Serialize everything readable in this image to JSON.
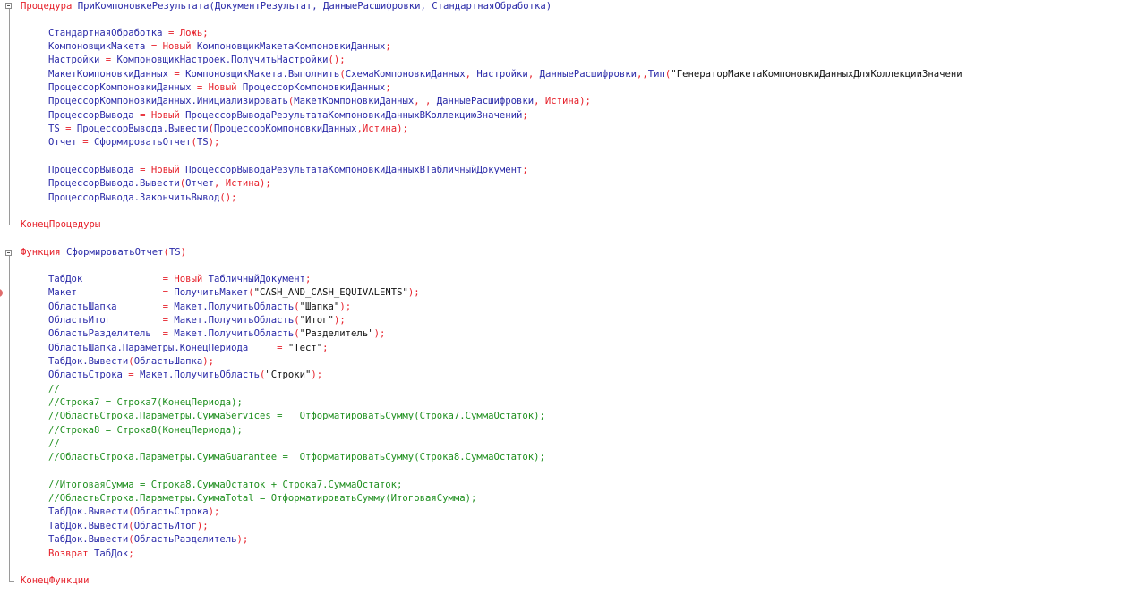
{
  "colors": {
    "keyword": "#e6202a",
    "identifier": "#2a2aa8",
    "string": "#111111",
    "comment": "#1f8f1f",
    "background": "#ffffff"
  },
  "icons": [
    "fold-collapse-icon",
    "breakpoint-icon"
  ],
  "lines": [
    [
      {
        "t": "k",
        "v": "Процедура "
      },
      {
        "t": "t",
        "v": "ПриКомпоновкеРезультата(ДокументРезультат, ДанныеРасшифровки, СтандартнаяОбработка)"
      }
    ],
    [
      {
        "t": "t",
        "v": "СтандартнаяОбработка "
      },
      {
        "t": "k",
        "v": "= Ложь;"
      }
    ],
    [
      {
        "t": "t",
        "v": "КомпоновщикМакета "
      },
      {
        "t": "k",
        "v": "= Новый "
      },
      {
        "t": "t",
        "v": "КомпоновщикМакетаКомпоновкиДанных"
      },
      {
        "t": "k",
        "v": ";"
      }
    ],
    [
      {
        "t": "t",
        "v": "Настройки "
      },
      {
        "t": "k",
        "v": "= "
      },
      {
        "t": "t",
        "v": "КомпоновщикНастроек.ПолучитьНастройки"
      },
      {
        "t": "k",
        "v": "();"
      }
    ],
    [
      {
        "t": "t",
        "v": "МакетКомпоновкиДанных "
      },
      {
        "t": "k",
        "v": "= "
      },
      {
        "t": "t",
        "v": "КомпоновщикМакета.Выполнить"
      },
      {
        "t": "k",
        "v": "("
      },
      {
        "t": "t",
        "v": "СхемаКомпоновкиДанных"
      },
      {
        "t": "k",
        "v": ", "
      },
      {
        "t": "t",
        "v": "Настройки"
      },
      {
        "t": "k",
        "v": ", "
      },
      {
        "t": "t",
        "v": "ДанныеРасшифровки"
      },
      {
        "t": "k",
        "v": ",,"
      },
      {
        "t": "t",
        "v": "Тип"
      },
      {
        "t": "k",
        "v": "("
      },
      {
        "t": "s",
        "v": "\"ГенераторМакетаКомпоновкиДанныхДляКоллекцииЗначени"
      }
    ],
    [
      {
        "t": "t",
        "v": "ПроцессорКомпоновкиДанных "
      },
      {
        "t": "k",
        "v": "= Новый "
      },
      {
        "t": "t",
        "v": "ПроцессорКомпоновкиДанных"
      },
      {
        "t": "k",
        "v": ";"
      }
    ],
    [
      {
        "t": "t",
        "v": "ПроцессорКомпоновкиДанных.Инициализировать"
      },
      {
        "t": "k",
        "v": "("
      },
      {
        "t": "t",
        "v": "МакетКомпоновкиДанных"
      },
      {
        "t": "k",
        "v": ", , "
      },
      {
        "t": "t",
        "v": "ДанныеРасшифровки"
      },
      {
        "t": "k",
        "v": ", Истина);"
      }
    ],
    [
      {
        "t": "t",
        "v": "ПроцессорВывода "
      },
      {
        "t": "k",
        "v": "= Новый "
      },
      {
        "t": "t",
        "v": "ПроцессорВыводаРезультатаКомпоновкиДанныхВКоллекциюЗначений"
      },
      {
        "t": "k",
        "v": ";"
      }
    ],
    [
      {
        "t": "t",
        "v": "TS "
      },
      {
        "t": "k",
        "v": "= "
      },
      {
        "t": "t",
        "v": "ПроцессорВывода.Вывести"
      },
      {
        "t": "k",
        "v": "("
      },
      {
        "t": "t",
        "v": "ПроцессорКомпоновкиДанных"
      },
      {
        "t": "k",
        "v": ",Истина);"
      }
    ],
    [
      {
        "t": "t",
        "v": "Отчет "
      },
      {
        "t": "k",
        "v": "= "
      },
      {
        "t": "t",
        "v": "СформироватьОтчет"
      },
      {
        "t": "k",
        "v": "("
      },
      {
        "t": "t",
        "v": "TS"
      },
      {
        "t": "k",
        "v": ");"
      }
    ],
    [
      {
        "t": "t",
        "v": "ПроцессорВывода "
      },
      {
        "t": "k",
        "v": "= Новый "
      },
      {
        "t": "t",
        "v": "ПроцессорВыводаРезультатаКомпоновкиДанныхВТабличныйДокумент"
      },
      {
        "t": "k",
        "v": ";"
      }
    ],
    [
      {
        "t": "t",
        "v": "ПроцессорВывода.Вывести"
      },
      {
        "t": "k",
        "v": "("
      },
      {
        "t": "t",
        "v": "Отчет"
      },
      {
        "t": "k",
        "v": ", Истина);"
      }
    ],
    [
      {
        "t": "t",
        "v": "ПроцессорВывода.ЗакончитьВывод"
      },
      {
        "t": "k",
        "v": "();"
      }
    ],
    [
      {
        "t": "k",
        "v": "КонецПроцедуры"
      }
    ],
    [
      {
        "t": "k",
        "v": "Функция "
      },
      {
        "t": "t",
        "v": "СформироватьОтчет"
      },
      {
        "t": "k",
        "v": "("
      },
      {
        "t": "t",
        "v": "TS"
      },
      {
        "t": "k",
        "v": ")"
      }
    ],
    [
      {
        "t": "t",
        "v": "ТабДок              "
      },
      {
        "t": "k",
        "v": "= Новый "
      },
      {
        "t": "t",
        "v": "ТабличныйДокумент"
      },
      {
        "t": "k",
        "v": ";"
      }
    ],
    [
      {
        "t": "t",
        "v": "Макет               "
      },
      {
        "t": "k",
        "v": "= "
      },
      {
        "t": "t",
        "v": "ПолучитьМакет"
      },
      {
        "t": "k",
        "v": "("
      },
      {
        "t": "s",
        "v": "\"CASH_AND_CASH_EQUIVALENTS\""
      },
      {
        "t": "k",
        "v": ");"
      }
    ],
    [
      {
        "t": "t",
        "v": "ОбластьШапка        "
      },
      {
        "t": "k",
        "v": "= "
      },
      {
        "t": "t",
        "v": "Макет.ПолучитьОбласть"
      },
      {
        "t": "k",
        "v": "("
      },
      {
        "t": "s",
        "v": "\"Шапка\""
      },
      {
        "t": "k",
        "v": ");"
      }
    ],
    [
      {
        "t": "t",
        "v": "ОбластьИтог         "
      },
      {
        "t": "k",
        "v": "= "
      },
      {
        "t": "t",
        "v": "Макет.ПолучитьОбласть"
      },
      {
        "t": "k",
        "v": "("
      },
      {
        "t": "s",
        "v": "\"Итог\""
      },
      {
        "t": "k",
        "v": ");"
      }
    ],
    [
      {
        "t": "t",
        "v": "ОбластьРазделитель  "
      },
      {
        "t": "k",
        "v": "= "
      },
      {
        "t": "t",
        "v": "Макет.ПолучитьОбласть"
      },
      {
        "t": "k",
        "v": "("
      },
      {
        "t": "s",
        "v": "\"Разделитель\""
      },
      {
        "t": "k",
        "v": ");"
      }
    ],
    [
      {
        "t": "t",
        "v": "ОбластьШапка.Параметры.КонецПериода     "
      },
      {
        "t": "k",
        "v": "= "
      },
      {
        "t": "s",
        "v": "\"Тест\""
      },
      {
        "t": "k",
        "v": ";"
      }
    ],
    [
      {
        "t": "t",
        "v": "ТабДок.Вывести"
      },
      {
        "t": "k",
        "v": "("
      },
      {
        "t": "t",
        "v": "ОбластьШапка"
      },
      {
        "t": "k",
        "v": ");"
      }
    ],
    [
      {
        "t": "t",
        "v": "ОбластьСтрока "
      },
      {
        "t": "k",
        "v": "= "
      },
      {
        "t": "t",
        "v": "Макет.ПолучитьОбласть"
      },
      {
        "t": "k",
        "v": "("
      },
      {
        "t": "s",
        "v": "\"Строки\""
      },
      {
        "t": "k",
        "v": ");"
      }
    ],
    [
      {
        "t": "c",
        "v": "//"
      }
    ],
    [
      {
        "t": "c",
        "v": "//Строка7 = Строка7(КонецПериода);"
      }
    ],
    [
      {
        "t": "c",
        "v": "//ОбластьСтрока.Параметры.СуммаServices =   ОтформатироватьСумму(Строка7.СуммаОстаток);"
      }
    ],
    [
      {
        "t": "c",
        "v": "//Строка8 = Строка8(КонецПериода);"
      }
    ],
    [
      {
        "t": "c",
        "v": "//"
      }
    ],
    [
      {
        "t": "c",
        "v": "//ОбластьСтрока.Параметры.СуммаGuarantee =  ОтформатироватьСумму(Строка8.СуммаОстаток);"
      }
    ],
    [
      {
        "t": "c",
        "v": "//ИтоговаяСумма = Строка8.СуммаОстаток + Строка7.СуммаОстаток;"
      }
    ],
    [
      {
        "t": "c",
        "v": "//ОбластьСтрока.Параметры.СуммаTotal = ОтформатироватьСумму(ИтоговаяСумма);"
      }
    ],
    [
      {
        "t": "t",
        "v": "ТабДок.Вывести"
      },
      {
        "t": "k",
        "v": "("
      },
      {
        "t": "t",
        "v": "ОбластьСтрока"
      },
      {
        "t": "k",
        "v": ");"
      }
    ],
    [
      {
        "t": "t",
        "v": "ТабДок.Вывести"
      },
      {
        "t": "k",
        "v": "("
      },
      {
        "t": "t",
        "v": "ОбластьИтог"
      },
      {
        "t": "k",
        "v": ");"
      }
    ],
    [
      {
        "t": "t",
        "v": "ТабДок.Вывести"
      },
      {
        "t": "k",
        "v": "("
      },
      {
        "t": "t",
        "v": "ОбластьРазделитель"
      },
      {
        "t": "k",
        "v": ");"
      }
    ],
    [
      {
        "t": "k",
        "v": "Возврат "
      },
      {
        "t": "t",
        "v": "ТабДок"
      },
      {
        "t": "k",
        "v": ";"
      }
    ],
    [
      {
        "t": "k",
        "v": "КонецФункции"
      }
    ]
  ]
}
